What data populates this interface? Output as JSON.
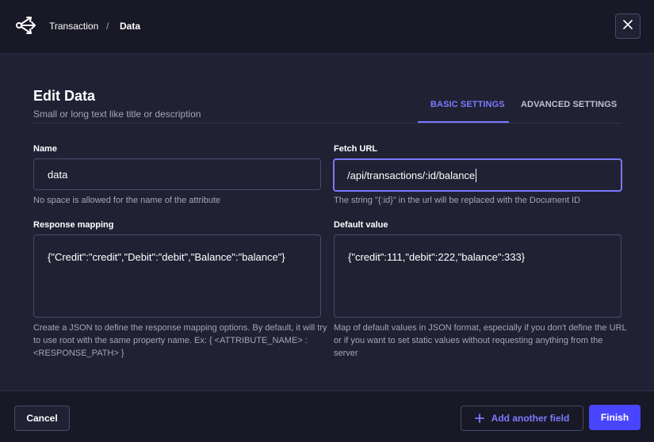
{
  "header": {
    "logo_icon": "relation-arrows-icon",
    "breadcrumb": [
      "Transaction",
      "Data"
    ],
    "separator": "/",
    "close_icon": "close-icon"
  },
  "page": {
    "title": "Edit Data",
    "subtitle": "Small or long text like title or description"
  },
  "tabs": [
    {
      "label": "BASIC SETTINGS",
      "active": true
    },
    {
      "label": "ADVANCED SETTINGS",
      "active": false
    }
  ],
  "fields": {
    "name": {
      "label": "Name",
      "value": "data",
      "hint": "No space is allowed for the name of the attribute"
    },
    "fetch_url": {
      "label": "Fetch URL",
      "value": "/api/transactions/:id/balance",
      "hint": "The string \"{:id}\" in the url will be replaced with the Document ID"
    },
    "response_mapping": {
      "label": "Response mapping",
      "value": "{\"Credit\":\"credit\",\"Debit\":\"debit\",\"Balance\":\"balance\"}",
      "hint": "Create a JSON to define the response mapping options. By default, it will try to use root with the same property name. Ex: { <ATTRIBUTE_NAME> : <RESPONSE_PATH> }"
    },
    "default_value": {
      "label": "Default value",
      "value": "{\"credit\":111,\"debit\":222,\"balance\":333}",
      "hint": "Map of default values in JSON format, especially if you don't define the URL or if you want to set static values without requesting anything from the server"
    }
  },
  "footer": {
    "cancel_label": "Cancel",
    "add_field_label": "Add another field",
    "finish_label": "Finish"
  },
  "colors": {
    "accent": "#7b79ff",
    "primary_button": "#4945ff",
    "background": "#212134",
    "header_background": "#181826"
  }
}
